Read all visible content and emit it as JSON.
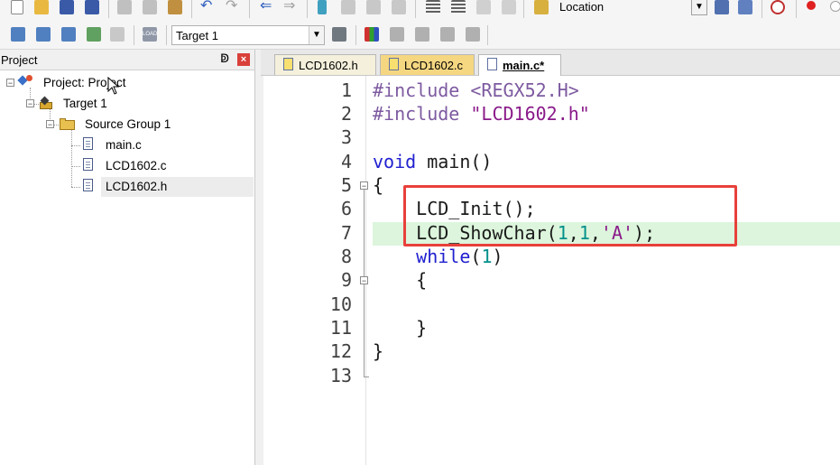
{
  "toolbar": {
    "location_label": "Location",
    "target_select": "Target 1"
  },
  "project_panel": {
    "title": "Project",
    "pin_glyph": "ↁ",
    "close_glyph": "×",
    "tree": [
      {
        "label": "Project: Project",
        "type": "project"
      },
      {
        "label": "Target 1",
        "type": "target"
      },
      {
        "label": "Source Group 1",
        "type": "group"
      },
      {
        "label": "main.c",
        "type": "file"
      },
      {
        "label": "LCD1602.c",
        "type": "file"
      },
      {
        "label": "LCD1602.h",
        "type": "file"
      }
    ]
  },
  "tabs": [
    {
      "label": "LCD1602.h"
    },
    {
      "label": "LCD1602.c"
    },
    {
      "label": "main.c*"
    }
  ],
  "editor": {
    "line_numbers": [
      "1",
      "2",
      "3",
      "4",
      "5",
      "6",
      "7",
      "8",
      "9",
      "10",
      "11",
      "12",
      "13"
    ],
    "lines": [
      {
        "pp": "#include",
        "rest": " <REGX52.H>"
      },
      {
        "pp": "#include",
        "str": " \"LCD1602.h\""
      },
      {},
      {
        "kw": "void",
        "rest": " main()"
      },
      {
        "rest": "{"
      },
      {
        "indent": "    ",
        "rest": "LCD_Init();"
      },
      {
        "indent": "    ",
        "fn": "LCD_ShowChar(",
        "n1": "1",
        "c1": ",",
        "n2": "1",
        "c2": ",",
        "ch": "'A'",
        "end": ");"
      },
      {
        "indent": "    ",
        "kw": "while",
        "p1": "(",
        "num": "1",
        "p2": ")"
      },
      {
        "indent": "    ",
        "rest": "{"
      },
      {},
      {
        "indent": "    ",
        "rest": "}"
      },
      {
        "rest": "}"
      },
      {}
    ]
  }
}
